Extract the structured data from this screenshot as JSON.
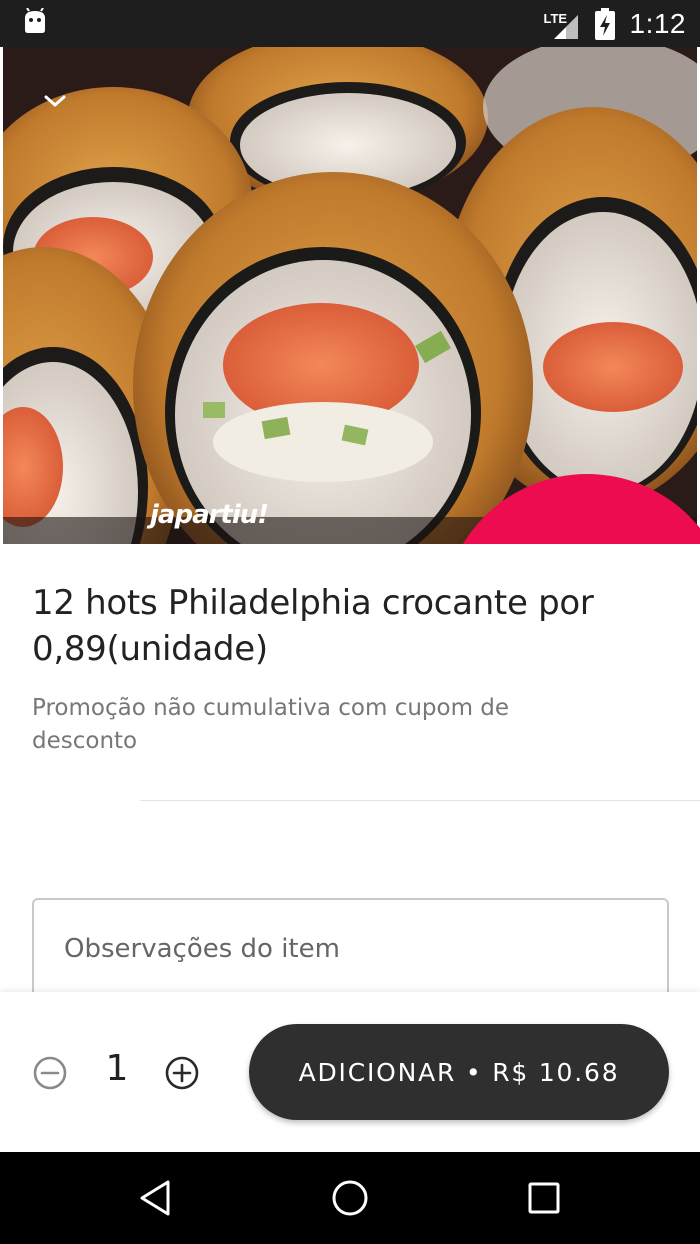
{
  "status_bar": {
    "network": "LTE",
    "time": "1:12",
    "icons": [
      "android-icon",
      "signal-icon",
      "battery-charging-icon"
    ]
  },
  "hero": {
    "watermark": "japartiu!",
    "collapse_icon": "chevron-down-icon"
  },
  "product": {
    "title": "12 hots Philadelphia crocante por 0,89(unidade)",
    "description": "Promoção não cumulativa com cupom de desconto"
  },
  "notes": {
    "placeholder": "Observações do item"
  },
  "action_bar": {
    "quantity": "1",
    "minus_icon": "minus-circle-icon",
    "plus_icon": "plus-circle-icon",
    "add_label": "ADICIONAR • R$ 10.68"
  },
  "nav_bar": {
    "icons": [
      "back-icon",
      "home-icon",
      "recents-icon"
    ]
  },
  "colors": {
    "accent": "#ec0c4f",
    "button_bg": "#2f2f2f",
    "status_bg": "#1e1e1e"
  }
}
